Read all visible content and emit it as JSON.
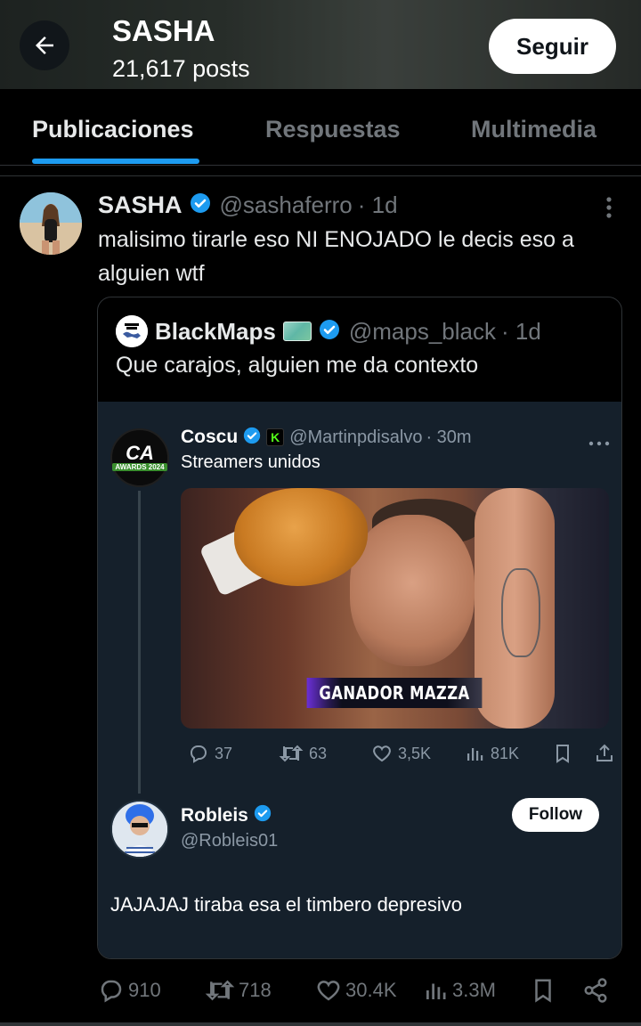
{
  "header": {
    "name": "SASHA",
    "posts_count": "21,617 posts",
    "follow_label": "Seguir"
  },
  "tabs": [
    {
      "label": "Publicaciones",
      "active": true
    },
    {
      "label": "Respuestas",
      "active": false
    },
    {
      "label": "Multimedia",
      "active": false
    }
  ],
  "tweet": {
    "author_name": "SASHA",
    "handle": "@sashaferro",
    "time": "· 1d",
    "text": "malisimo tirarle eso NI ENOJADO le decis eso a alguien wtf",
    "stats": {
      "replies": "910",
      "retweets": "718",
      "likes": "30.4K",
      "views": "3.3M"
    }
  },
  "quote": {
    "avatar_text": "black maps",
    "author_name": "BlackMaps",
    "handle": "@maps_black",
    "time": "· 1d",
    "text": "Que carajos, alguien me da contexto"
  },
  "embedded": {
    "coscu": {
      "avatar_text": "CA",
      "avatar_badge": "AWARDS 2024",
      "name": "Coscu",
      "handle": "@Martinpdisalvo",
      "time": "· 30m",
      "text": "Streamers unidos",
      "media_caption": "GANADOR MAZZA",
      "stats": {
        "replies": "37",
        "retweets": "63",
        "likes": "3,5K",
        "views": "81K"
      }
    },
    "robleis": {
      "name": "Robleis",
      "handle": "@Robleis01",
      "follow_label": "Follow",
      "text": "JAJAJAJ tiraba esa el timbero depresivo"
    }
  },
  "colors": {
    "accent": "#1d9bf0",
    "background": "#000000",
    "panel": "#15202b",
    "muted": "#71767b"
  }
}
